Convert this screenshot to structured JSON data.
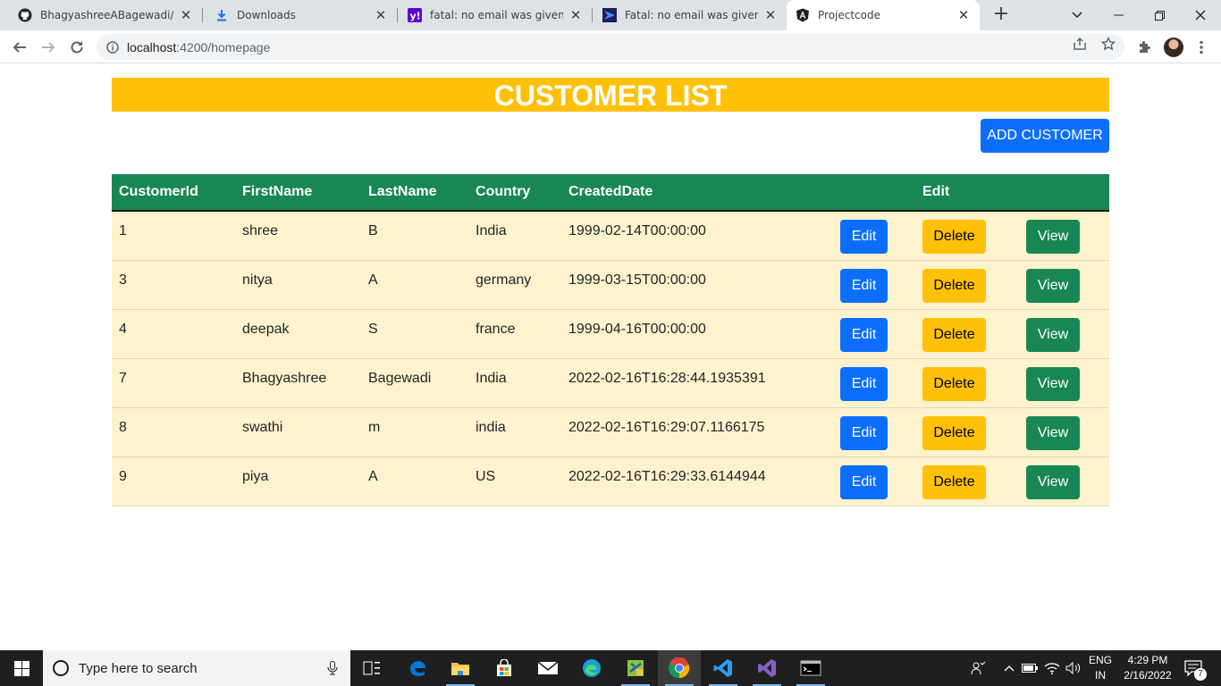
{
  "browser": {
    "tabs": [
      {
        "title": "BhagyashreeABagewadi/proj",
        "icon": "github-icon"
      },
      {
        "title": "Downloads",
        "icon": "download-icon"
      },
      {
        "title": "fatal: no email was given and",
        "icon": "yahoo-icon"
      },
      {
        "title": "Fatal: no email was given and",
        "icon": "vs-icon"
      },
      {
        "title": "Projectcode",
        "icon": "angular-icon"
      }
    ],
    "url_host": "localhost",
    "url_path": ":4200/homepage"
  },
  "page": {
    "heading": "CUSTOMER LIST",
    "add_button": "ADD CUSTOMER",
    "columns": [
      "CustomerId",
      "FirstName",
      "LastName",
      "Country",
      "CreatedDate",
      "",
      "Edit",
      ""
    ],
    "rows": [
      {
        "id": "1",
        "first": "shree",
        "last": "B",
        "country": "India",
        "created": "1999-02-14T00:00:00"
      },
      {
        "id": "3",
        "first": "nitya",
        "last": "A",
        "country": "germany",
        "created": "1999-03-15T00:00:00"
      },
      {
        "id": "4",
        "first": "deepak",
        "last": "S",
        "country": "france",
        "created": "1999-04-16T00:00:00"
      },
      {
        "id": "7",
        "first": "Bhagyashree",
        "last": "Bagewadi",
        "country": "India",
        "created": "2022-02-16T16:28:44.1935391"
      },
      {
        "id": "8",
        "first": "swathi",
        "last": "m",
        "country": "india",
        "created": "2022-02-16T16:29:07.1166175"
      },
      {
        "id": "9",
        "first": "piya",
        "last": "A",
        "country": "US",
        "created": "2022-02-16T16:29:33.6144944"
      }
    ],
    "actions": {
      "edit": "Edit",
      "delete": "Delete",
      "view": "View"
    }
  },
  "taskbar": {
    "search_placeholder": "Type here to search",
    "lang_top": "ENG",
    "lang_bottom": "IN",
    "time": "4:29 PM",
    "date": "2/16/2022",
    "notification_count": "7"
  },
  "colors": {
    "banner": "#ffc107",
    "primary": "#0d6efd",
    "success": "#198754",
    "row": "#fff3cd"
  }
}
